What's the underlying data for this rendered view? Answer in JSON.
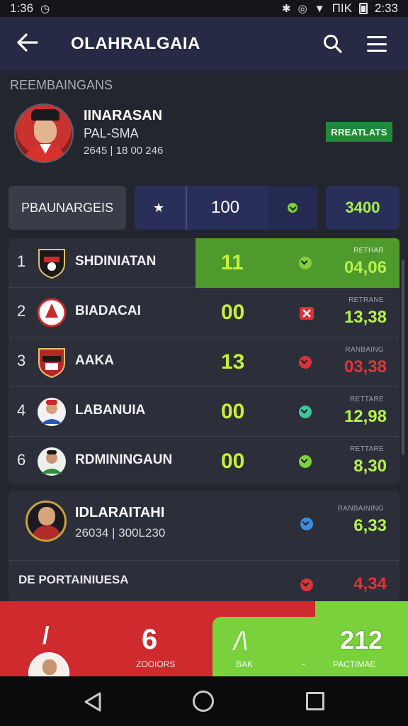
{
  "status_bar": {
    "time": "1:36",
    "right_text": "ΠΙΚ",
    "clock": "2:33"
  },
  "app_bar": {
    "title": "OLAHRALGAIA"
  },
  "section_label": "REEMBAINGANS",
  "profile": {
    "name": "IINARASAN",
    "subtitle": "PAL-SMA",
    "meta": "2645 | 18 00 246",
    "badge": "RREATLATS"
  },
  "filters": {
    "category": "PBAUNARGEIS",
    "value": "100",
    "total": "3400"
  },
  "rows": [
    {
      "rank": "1",
      "team": "SHDINIATAN",
      "score": "11",
      "label": "RETHAR",
      "value": "04,06",
      "value_color": "#b6f04a",
      "mark_color": "#7fd03a",
      "highlight": true
    },
    {
      "rank": "2",
      "team": "BIADACAI",
      "score": "00",
      "label": "RETRANE",
      "value": "13,38",
      "value_color": "#b6f04a",
      "mark_color": "#d9333a",
      "highlight": false
    },
    {
      "rank": "3",
      "team": "AAKA",
      "score": "13",
      "label": "RANBAING",
      "value": "03,38",
      "value_color": "#e0343a",
      "mark_color": "#d9333a",
      "highlight": false
    },
    {
      "rank": "4",
      "team": "LABANUIA",
      "score": "00",
      "label": "RETTARE",
      "value": "12,98",
      "value_color": "#b6f04a",
      "mark_color": "#3fc59a",
      "highlight": false
    },
    {
      "rank": "6",
      "team": "RDMININGAUN",
      "score": "00",
      "label": "RETTARE",
      "value": "8,30",
      "value_color": "#b6f04a",
      "mark_color": "#7fd03a",
      "highlight": false
    }
  ],
  "team_card": {
    "name": "IDLARAITAHI",
    "meta": "26034 | 300L230",
    "label": "RANBAINING",
    "value": "6,33",
    "foot_text": "DE PORTAINIUESA",
    "foot_value": "4,34"
  },
  "action_bar": {
    "big_number": "6",
    "label_left": "ZOOIORS",
    "label_mid": "BAK",
    "dash": "-",
    "big_number_right": "212",
    "label_right": "PACTIMAE"
  },
  "icons": {
    "back": "arrow-left-icon",
    "search": "search-icon",
    "menu": "menu-icon"
  },
  "colors": {
    "app_bar": "#262a44",
    "accent_green": "#79d23b",
    "accent_red": "#cf2a2d",
    "score_yellow": "#c6f03a"
  }
}
